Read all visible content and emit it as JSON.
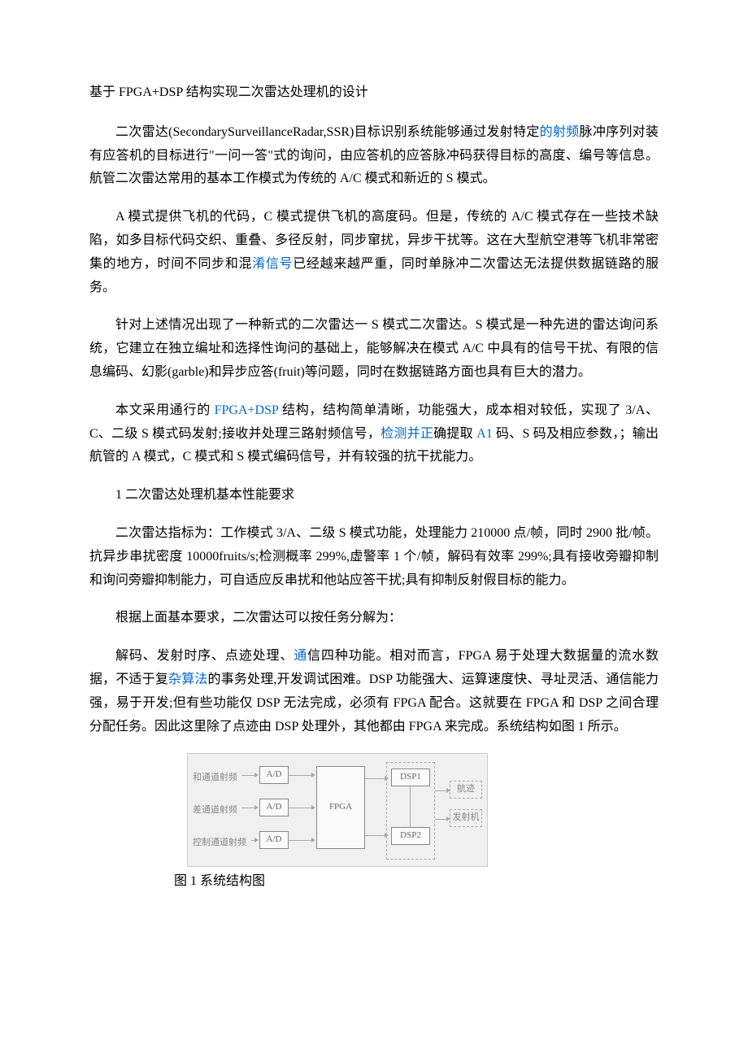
{
  "title": "基于 FPGA+DSP 结构实现二次雷达处理机的设计",
  "para1_a": "二次雷达(SecondarySurveillanceRadar,SSR)目标识别系统能够通过发射特定",
  "para1_link1": "的射频",
  "para1_b": "脉冲序列对装有应答机的目标进行\"一问一答\"式的询问，由应答机的应答脉冲码获得目标的高度、编号等信息。航管二次雷达常用的基本工作模式为传统的 A/C 模式和新近的 S 模式。",
  "para2_a": "A 模式提供飞机的代码，C 模式提供飞机的高度码。但是，传统的 A/C 模式存在一些技术缺陷，如多目标代码交织、重叠、多径反射，同步窜扰，异步干扰等。这在大型航空港等飞机非常密集的地方，时间不同步和混",
  "para2_link1": "淆信号",
  "para2_b": "已经越来越严重，同时单脉冲二次雷达无法提供数据链路的服务。",
  "para3": "针对上述情况出现了一种新式的二次雷达一 S 模式二次雷达。S 模式是一种先进的雷达询问系统，它建立在独立编址和选择性询问的基础上，能够解决在模式 A/C 中具有的信号干扰、有限的信息编码、幻影(garble)和异步应答(fruit)等问题，同时在数据链路方面也具有巨大的潜力。",
  "para4_a": "本文采用通行的 ",
  "para4_link1": "FPGA+DSP",
  "para4_b": " 结构，结构简单清晰，功能强大，成本相对较低，实现了 3/A、C、二级 S 模式码发射;接收并处理三路射频信号，",
  "para4_link2": "检测并正",
  "para4_c": "确提取 ",
  "para4_link3": "A1",
  "para4_d": " 码、S 码及相应参数，；输出航管的 A 模式，C 模式和 S 模式编码信号，并有较强的抗干扰能力。",
  "heading1": "1 二次雷达处理机基本性能要求",
  "para5": "二次雷达指标为：工作模式 3/A、二级 S 模式功能，处理能力 210000 点/帧，同时 2900 批/帧。抗异步串扰密度 10000fruits/s;检测概率 299%,虚警率 1 个/帧，解码有效率 299%;具有接收旁瓣抑制和询问旁瓣抑制能力，可自适应反串扰和他站应答干扰;具有抑制反射假目标的能力。",
  "para6": "根据上面基本要求，二次雷达可以按任务分解为：",
  "para7_a": "解码、发射时序、点迹处理、",
  "para7_link1": "通",
  "para7_b": "信四种功能。相对而言，FPGA 易于处理大数据量的流水数据，不适于复",
  "para7_link2": "杂算法",
  "para7_c": "的事务处理,开发调试困难。DSP 功能强大、运算速度快、寻址灵活、通信能力强，易于开发;但有些功能仅 DSP 无法完成，必须有 FPGA 配合。这就要在 FPGA 和 DSP 之间合理分配任务。因此这里除了点迹由 DSP 处理外，其他都由 FPGA 来完成。系统结构如图 1 所示。",
  "caption": "图 1 系统结构图",
  "diagram": {
    "label1": "和通道射频",
    "label2": "差通道射频",
    "label3": "控制通道射频",
    "ad": "A/D",
    "fpga": "FPGA",
    "dsp1": "DSP1",
    "dsp2": "DSP2",
    "out1": "航迹",
    "out2": "发射机"
  }
}
